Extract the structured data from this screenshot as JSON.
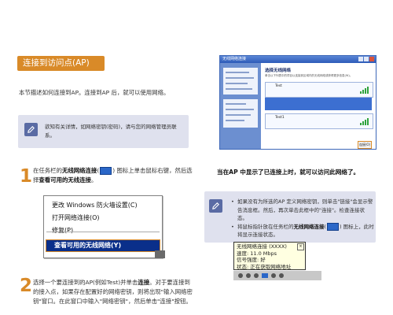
{
  "section": {
    "title": "连接到访问点(AP)",
    "intro": "本节描述如何连接到AP。连接到AP 后，就可以使用网络。"
  },
  "note1": {
    "icon": "pencil-icon",
    "text": "欲知有关详情，如网络密钥(密码)，请与您的网络管理员联系。"
  },
  "step1": {
    "number": "1",
    "prefix": "在任务栏的",
    "bold1": "无线网络连接",
    "middle": "图标上单击鼠标右键，然后选择",
    "bold2": "查看可用的无线连接",
    "suffix": "。"
  },
  "context_menu": {
    "items": [
      "更改 Windows 防火墙设置(C)",
      "打开网络连接(O)",
      "修复(P)"
    ],
    "selected": "查看可用的无线网络(Y)"
  },
  "step2": {
    "number": "2",
    "prefix": "选择一个要连接到的AP(例如Test)并单击",
    "bold1": "连接",
    "middle": "。对于要连接到的接入点，如果存在配置好的网络密钥，则将出现\"输入网络密钥\"窗口。在此窗口中输入\"网络密钥\"，然后单击\"连接\"按钮。",
    "suffix": ""
  },
  "screenshot": {
    "window_title": "无线网络连接",
    "heading": "选择无线网络",
    "subtitle": "单击以下列表中的项目以连接到区域内的无线网络或获得更多信息(W)。",
    "networks": [
      "Test",
      "Test1"
    ],
    "button": "连接(O)"
  },
  "tip": {
    "title": "当在AP 中显示了已连接上时，就可以访问此网络了。",
    "bullet1": "如果没有为所选的AP 定义网络密钥，则单击\"链接\"会显示警告消息框。然后，再次单击此框中的\"连接\"。检查连接状态。",
    "bullet2_prefix": "将鼠标指针放在任务栏的",
    "bullet2_bold": "无线网络连接",
    "bullet2_suffix": "图标上，此时将显示连接状态。"
  },
  "tooltip": {
    "line1": "无线网络连接 (XXXX)",
    "line2": "速度: 11.0 Mbps",
    "line3": "信号强度: 好",
    "line4": "状态: 正在获取网络地址"
  }
}
